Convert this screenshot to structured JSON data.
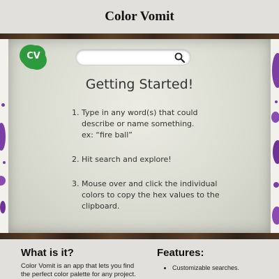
{
  "site": {
    "title": "Color Vomit"
  },
  "logo": {
    "text": "CV",
    "color": "#2d9b3d"
  },
  "search": {
    "value": "",
    "placeholder": "",
    "icon": "search-icon"
  },
  "hero": {
    "heading": "Getting Started!",
    "steps": [
      {
        "num": "1.",
        "lines": [
          "Type in any word(s) that could",
          "describe or name something.",
          "ex: “fire ball”"
        ]
      },
      {
        "num": "2.",
        "lines": [
          "Hit search and explore!"
        ]
      },
      {
        "num": "3.",
        "lines": [
          "Mouse over and click the individual",
          "colors to copy the hex values to the",
          "clipboard."
        ]
      }
    ]
  },
  "about": {
    "title": "What is it?",
    "text": "Color Vomit is an app that lets you find the perfect color palette for any project."
  },
  "features": {
    "title": "Features:",
    "items": [
      "Customizable searches."
    ]
  },
  "colors": {
    "splatter": "#7b3fa3",
    "wood": "#4a3522",
    "panel": "#d9dad0"
  }
}
